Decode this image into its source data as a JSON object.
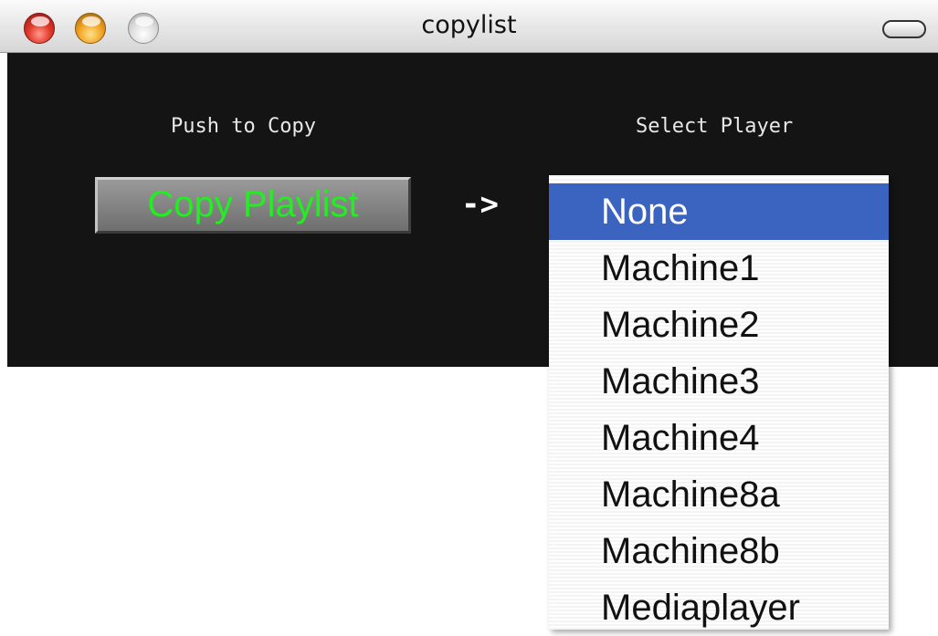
{
  "window": {
    "title": "copylist"
  },
  "panel": {
    "copy_caption": "Push to Copy",
    "player_caption": "Select Player",
    "copy_button_label": "Copy Playlist",
    "arrow_text": "->"
  },
  "player_menu": {
    "selected_index": 0,
    "options": [
      "None",
      "Machine1",
      "Machine2",
      "Machine3",
      "Machine4",
      "Machine8a",
      "Machine8b",
      "Mediaplayer"
    ]
  },
  "colors": {
    "panel_background": "#141414",
    "button_text": "#22ee22",
    "menu_highlight": "#3a64c0"
  }
}
